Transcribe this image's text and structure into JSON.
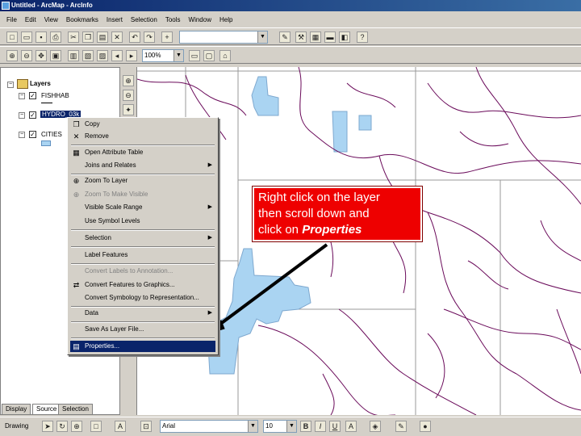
{
  "window": {
    "title": "Untitled - ArcMap - ArcInfo"
  },
  "menubar": {
    "items": [
      "File",
      "Edit",
      "View",
      "Bookmarks",
      "Insert",
      "Selection",
      "Tools",
      "Window",
      "Help"
    ]
  },
  "toolbar": {
    "zoom": "100%"
  },
  "toc": {
    "root": "Layers",
    "layers": [
      "FISHHAB",
      "HYDRO_03k",
      "CITIES"
    ]
  },
  "tabs": [
    "Display",
    "Source",
    "Selection"
  ],
  "context_menu": {
    "items": [
      {
        "label": "Copy",
        "icon": "copy-icon",
        "disabled": false,
        "submenu": false
      },
      {
        "label": "Remove",
        "icon": "remove-x-icon",
        "disabled": false,
        "submenu": false
      },
      {
        "label": "Open Attribute Table",
        "icon": "table-icon",
        "disabled": false,
        "submenu": false
      },
      {
        "label": "Joins and Relates",
        "icon": "",
        "disabled": false,
        "submenu": true
      },
      {
        "label": "Zoom To Layer",
        "icon": "zoom-layer-icon",
        "disabled": false,
        "submenu": false
      },
      {
        "label": "Zoom To Make Visible",
        "icon": "zoom-visible-icon",
        "disabled": true,
        "submenu": false
      },
      {
        "label": "Visible Scale Range",
        "icon": "",
        "disabled": false,
        "submenu": true
      },
      {
        "label": "Use Symbol Levels",
        "icon": "",
        "disabled": false,
        "submenu": false
      },
      {
        "label": "Selection",
        "icon": "",
        "disabled": false,
        "submenu": true
      },
      {
        "label": "Label Features",
        "icon": "",
        "disabled": false,
        "submenu": false
      },
      {
        "label": "Convert Labels to Annotation...",
        "icon": "",
        "disabled": true,
        "submenu": false
      },
      {
        "label": "Convert Features to Graphics...",
        "icon": "convert-graphics-icon",
        "disabled": false,
        "submenu": false
      },
      {
        "label": "Convert Symbology to Representation...",
        "icon": "",
        "disabled": false,
        "submenu": false
      },
      {
        "label": "Data",
        "icon": "",
        "disabled": false,
        "submenu": true
      },
      {
        "label": "Save As Layer File...",
        "icon": "",
        "disabled": false,
        "submenu": false
      },
      {
        "label": "Properties...",
        "icon": "properties-icon",
        "disabled": false,
        "submenu": false
      }
    ]
  },
  "callout": {
    "line1": "Right click on the layer",
    "line2": "then scroll down and",
    "line3_prefix": "click on ",
    "line3_emph": "Properties"
  },
  "drawing_toolbar": {
    "label": "Drawing",
    "font": "Arial",
    "size": "10"
  },
  "colors": {
    "lake_fill": "#aad4f2",
    "river": "#6a0a5a",
    "callout": "#ee0000",
    "selected_menu": "#0a246a"
  }
}
